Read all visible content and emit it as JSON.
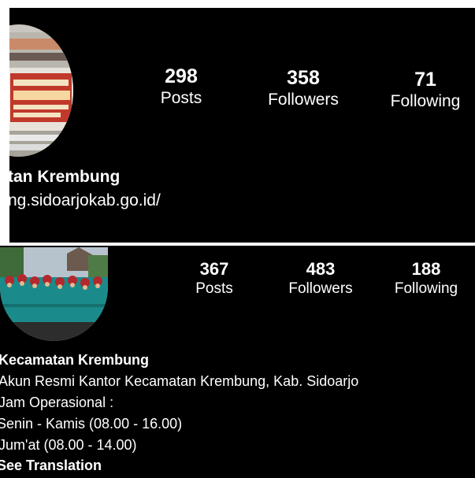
{
  "panel_top": {
    "stats": [
      {
        "value": "298",
        "label": "Posts"
      },
      {
        "value": "358",
        "label": "Followers"
      },
      {
        "value": "71",
        "label": "Following"
      }
    ],
    "name": "tan Krembung",
    "link": "ng.sidoarjokab.go.id/"
  },
  "panel_bottom": {
    "stats": [
      {
        "value": "367",
        "label": "Posts"
      },
      {
        "value": "483",
        "label": "Followers"
      },
      {
        "value": "188",
        "label": "Following"
      }
    ],
    "name": "Kecamatan Krembung",
    "bio": [
      "Akun Resmi Kantor Kecamatan Krembung, Kab. Sidoarjo",
      "Jam Operasional :",
      "Senin - Kamis (08.00 - 16.00)",
      "Jum'at (08.00 - 14.00)"
    ],
    "see_translation": "See Translation"
  },
  "colors": {
    "background": "#000000",
    "text": "#ffffff",
    "avatar_sign_red": "#c0392b",
    "uniform_teal": "#1b8a8a"
  },
  "icons": {
    "avatar_top": "office-building-sign-photo",
    "avatar_bottom": "group-photo"
  }
}
